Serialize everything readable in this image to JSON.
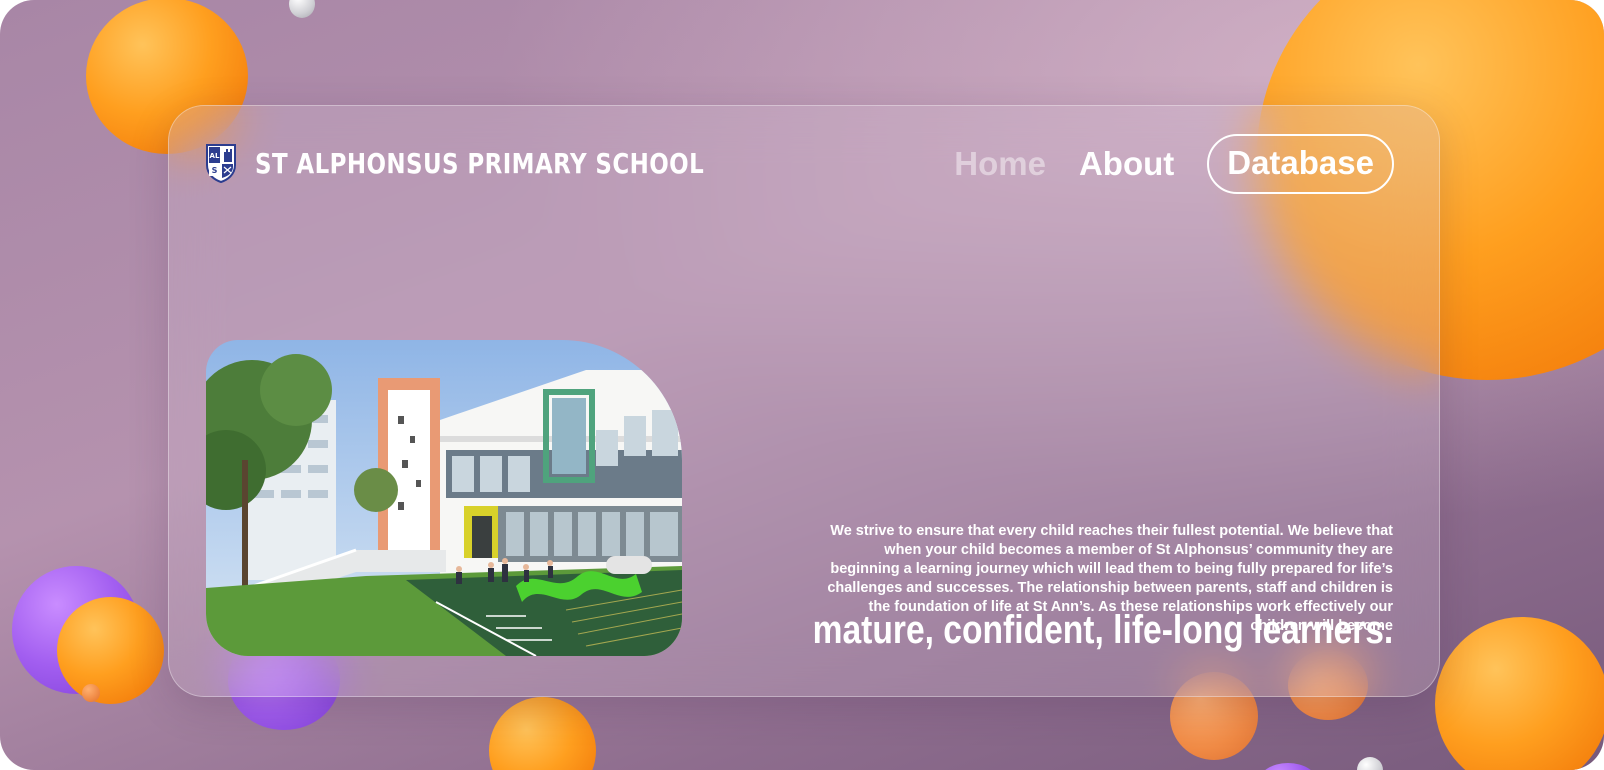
{
  "header": {
    "crest_letters": [
      "AL",
      "S"
    ],
    "school_name": "ST ALPHONSUS PRIMARY SCHOOL"
  },
  "nav": {
    "home": "Home",
    "about": "About",
    "database": "Database"
  },
  "hero": {
    "image_alt": "school building photo"
  },
  "content": {
    "blurb": "We strive to ensure that every child reaches their fullest potential. We believe that when your child becomes a member of St Alphonsus’ community they are beginning a learning journey which will lead them to being fully prepared for life’s challenges and successes. The relationship between parents, staff and children is the foundation of life at St Ann’s. As these relationships work effectively our children will become",
    "tagline": "mature, confident, life-long learners."
  },
  "colors": {
    "background": "#a886a6",
    "orb_orange": "#ff9f1f",
    "orb_purple": "#a25ef0",
    "text": "#ffffff",
    "crest_blue": "#2c3d8f"
  }
}
